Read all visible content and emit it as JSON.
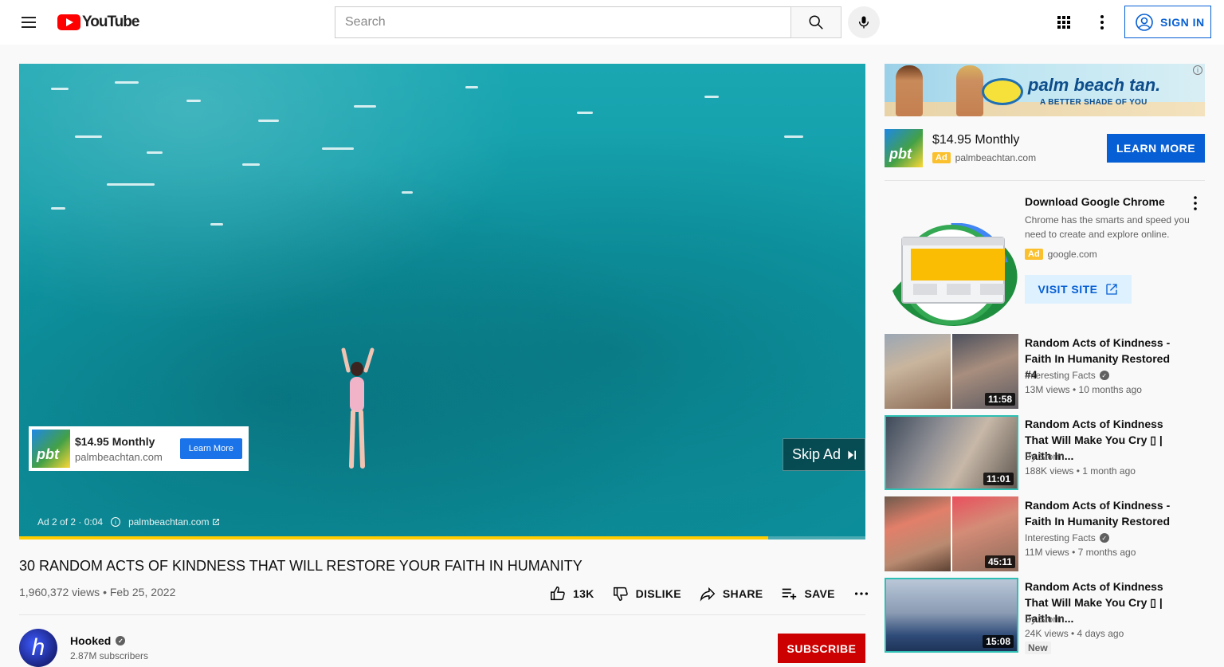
{
  "masthead": {
    "logo_text": "YouTube",
    "search_placeholder": "Search",
    "signin_label": "SIGN IN",
    "icons": [
      "menu-icon",
      "search-icon",
      "mic-icon",
      "apps-icon",
      "more-vert-icon",
      "account-icon"
    ]
  },
  "player": {
    "ad_progress": 0.885,
    "overlay_ad": {
      "logo_text": "pbt",
      "title": "$14.95 Monthly",
      "domain": "palmbeachtan.com",
      "cta": "Learn More"
    },
    "skip_label": "Skip Ad",
    "ad_status": "Ad 2 of 2 · 0:04",
    "ad_domain": "palmbeachtan.com",
    "colors": {
      "progress": "#ffcc00",
      "water": "#11a3ad"
    }
  },
  "video": {
    "title": "30 RANDOM ACTS OF KINDNESS THAT WILL RESTORE YOUR FAITH IN HUMANITY",
    "views_date": "1,960,372 views • Feb 25, 2022",
    "like_count": "13K",
    "dislike_label": "DISLIKE",
    "share_label": "SHARE",
    "save_label": "SAVE"
  },
  "channel": {
    "avatar_letter": "h",
    "name": "Hooked",
    "subscribers": "2.87M subscribers",
    "subscribe_label": "SUBSCRIBE",
    "colors": {
      "subscribe": "#cc0000"
    }
  },
  "sidebar": {
    "banner": {
      "brand": "palm beach tan.",
      "tagline": "A BETTER SHADE OF YOU"
    },
    "companion": {
      "logo_text": "pbt",
      "title": "$14.95 Monthly",
      "ad_badge": "Ad",
      "domain": "palmbeachtan.com",
      "cta": "LEARN MORE"
    },
    "chrome_ad": {
      "title": "Download Google Chrome",
      "description": "Chrome has the smarts and speed you need to create and explore online.",
      "ad_badge": "Ad",
      "domain": "google.com",
      "cta": "VISIT SITE"
    },
    "recommendations": [
      {
        "title": "Random Acts of Kindness - Faith In Humanity Restored #4",
        "channel": "Interesting Facts",
        "verified": true,
        "meta": "13M views • 10 months ago",
        "duration": "11:58"
      },
      {
        "title": "Random Acts of Kindness That Will Make You Cry ▯ | Faith In...",
        "channel": "By Storm",
        "verified": false,
        "meta": "188K views • 1 month ago",
        "duration": "11:01"
      },
      {
        "title": "Random Acts of Kindness - Faith In Humanity Restored",
        "channel": "Interesting Facts",
        "verified": true,
        "meta": "11M views • 7 months ago",
        "duration": "45:11"
      },
      {
        "title": "Random Acts of Kindness That Will Make You Cry ▯ | Faith In...",
        "channel": "By Storm",
        "verified": false,
        "meta": "24K views • 4 days ago",
        "duration": "15:08",
        "badge": "New"
      }
    ]
  }
}
